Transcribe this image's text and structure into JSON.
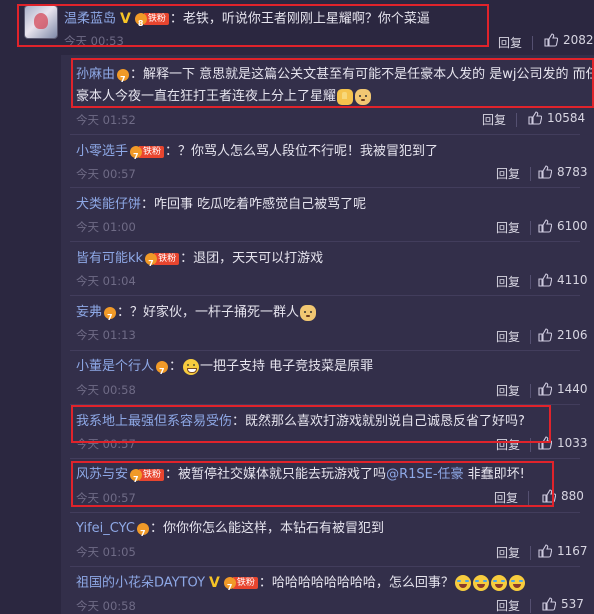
{
  "labels": {
    "reply": "回复"
  },
  "colors": {
    "username": "#8ea8e6",
    "highlight_box": "#e0232b",
    "fan_badge": "#e8452f",
    "background": "#2b2740"
  },
  "top_comment": {
    "username": "温柔蓝岛",
    "badge_v": "V",
    "fan_badge_label": "铁粉",
    "fan_badge_level": "8",
    "separator": "：",
    "text": "老铁，听说你王者刚刚上星耀啊？你个菜逼",
    "time": "今天 00:53",
    "likes": "2082"
  },
  "replies": [
    {
      "username": "孙麻由",
      "fan_badge_level": "7",
      "separator": "：",
      "text_line1": "解释一下 意思就是这篇公关文甚至有可能不是任豪本人发的 是wj公司发的 而任",
      "text_line2": "豪本人今夜一直在狂打王者连夜上分上了星耀",
      "emojis": [
        "thumb-emoji",
        "doge-emoji"
      ],
      "time": "今天 01:52",
      "likes": "10584"
    },
    {
      "username": "小零选手",
      "fan_badge_label": "铁粉",
      "fan_badge_level": "7",
      "separator": "：",
      "text": "？你骂人怎么骂人段位不行呢！我被冒犯到了",
      "time": "今天 00:57",
      "likes": "8783"
    },
    {
      "username": "犬类能仔饼",
      "separator": "：",
      "text": "咋回事 吃瓜吃着咋感觉自己被骂了呢",
      "time": "今天 01:00",
      "likes": "6100"
    },
    {
      "username": "皆有可能kk",
      "fan_badge_label": "铁粉",
      "fan_badge_level": "7",
      "separator": "：",
      "text": "退团，天天可以打游戏",
      "time": "今天 01:04",
      "likes": "4110"
    },
    {
      "username": "妄弗",
      "fan_badge_level": "7",
      "separator": "：",
      "text": "？好家伙，一杆子捅死一群人",
      "emojis": [
        "doge-emoji"
      ],
      "time": "今天 01:13",
      "likes": "2106"
    },
    {
      "username": "小董是个行人",
      "fan_badge_level": "7",
      "separator": "：",
      "text": "一把子支持 电子竞技菜是原罪",
      "emojis_before": [
        "grin-emoji"
      ],
      "time": "今天 00:58",
      "likes": "1440"
    },
    {
      "username": "我系地上最强但系容易受伤",
      "separator": "：",
      "text": "既然那么喜欢打游戏就别说自己诚恳反省了好吗?",
      "time": "今天 00:57",
      "likes": "1033"
    },
    {
      "username": "风苏与安",
      "fan_badge_label": "铁粉",
      "fan_badge_level": "7",
      "separator": "：",
      "text": "被暂停社交媒体就只能去玩游戏了吗",
      "mention": "@R1SE-任豪",
      "text_after": " 非蠢即坏!",
      "time": "今天 00:57",
      "likes": "880"
    },
    {
      "username": "Yifei_CYC",
      "fan_badge_level": "7",
      "separator": "：",
      "text": "你你你怎么能这样，本钻石有被冒犯到",
      "time": "今天 01:05",
      "likes": "1167"
    },
    {
      "username": "祖国的小花朵DAYTOY",
      "badge_v": "V",
      "fan_badge_label": "铁粉",
      "fan_badge_level": "7",
      "separator": "：",
      "text": "哈哈哈哈哈哈哈哈，怎么回事？",
      "emojis": [
        "lol-emoji",
        "lol-emoji",
        "lol-emoji",
        "lol-emoji"
      ],
      "time": "今天 00:58",
      "likes": "537"
    }
  ]
}
